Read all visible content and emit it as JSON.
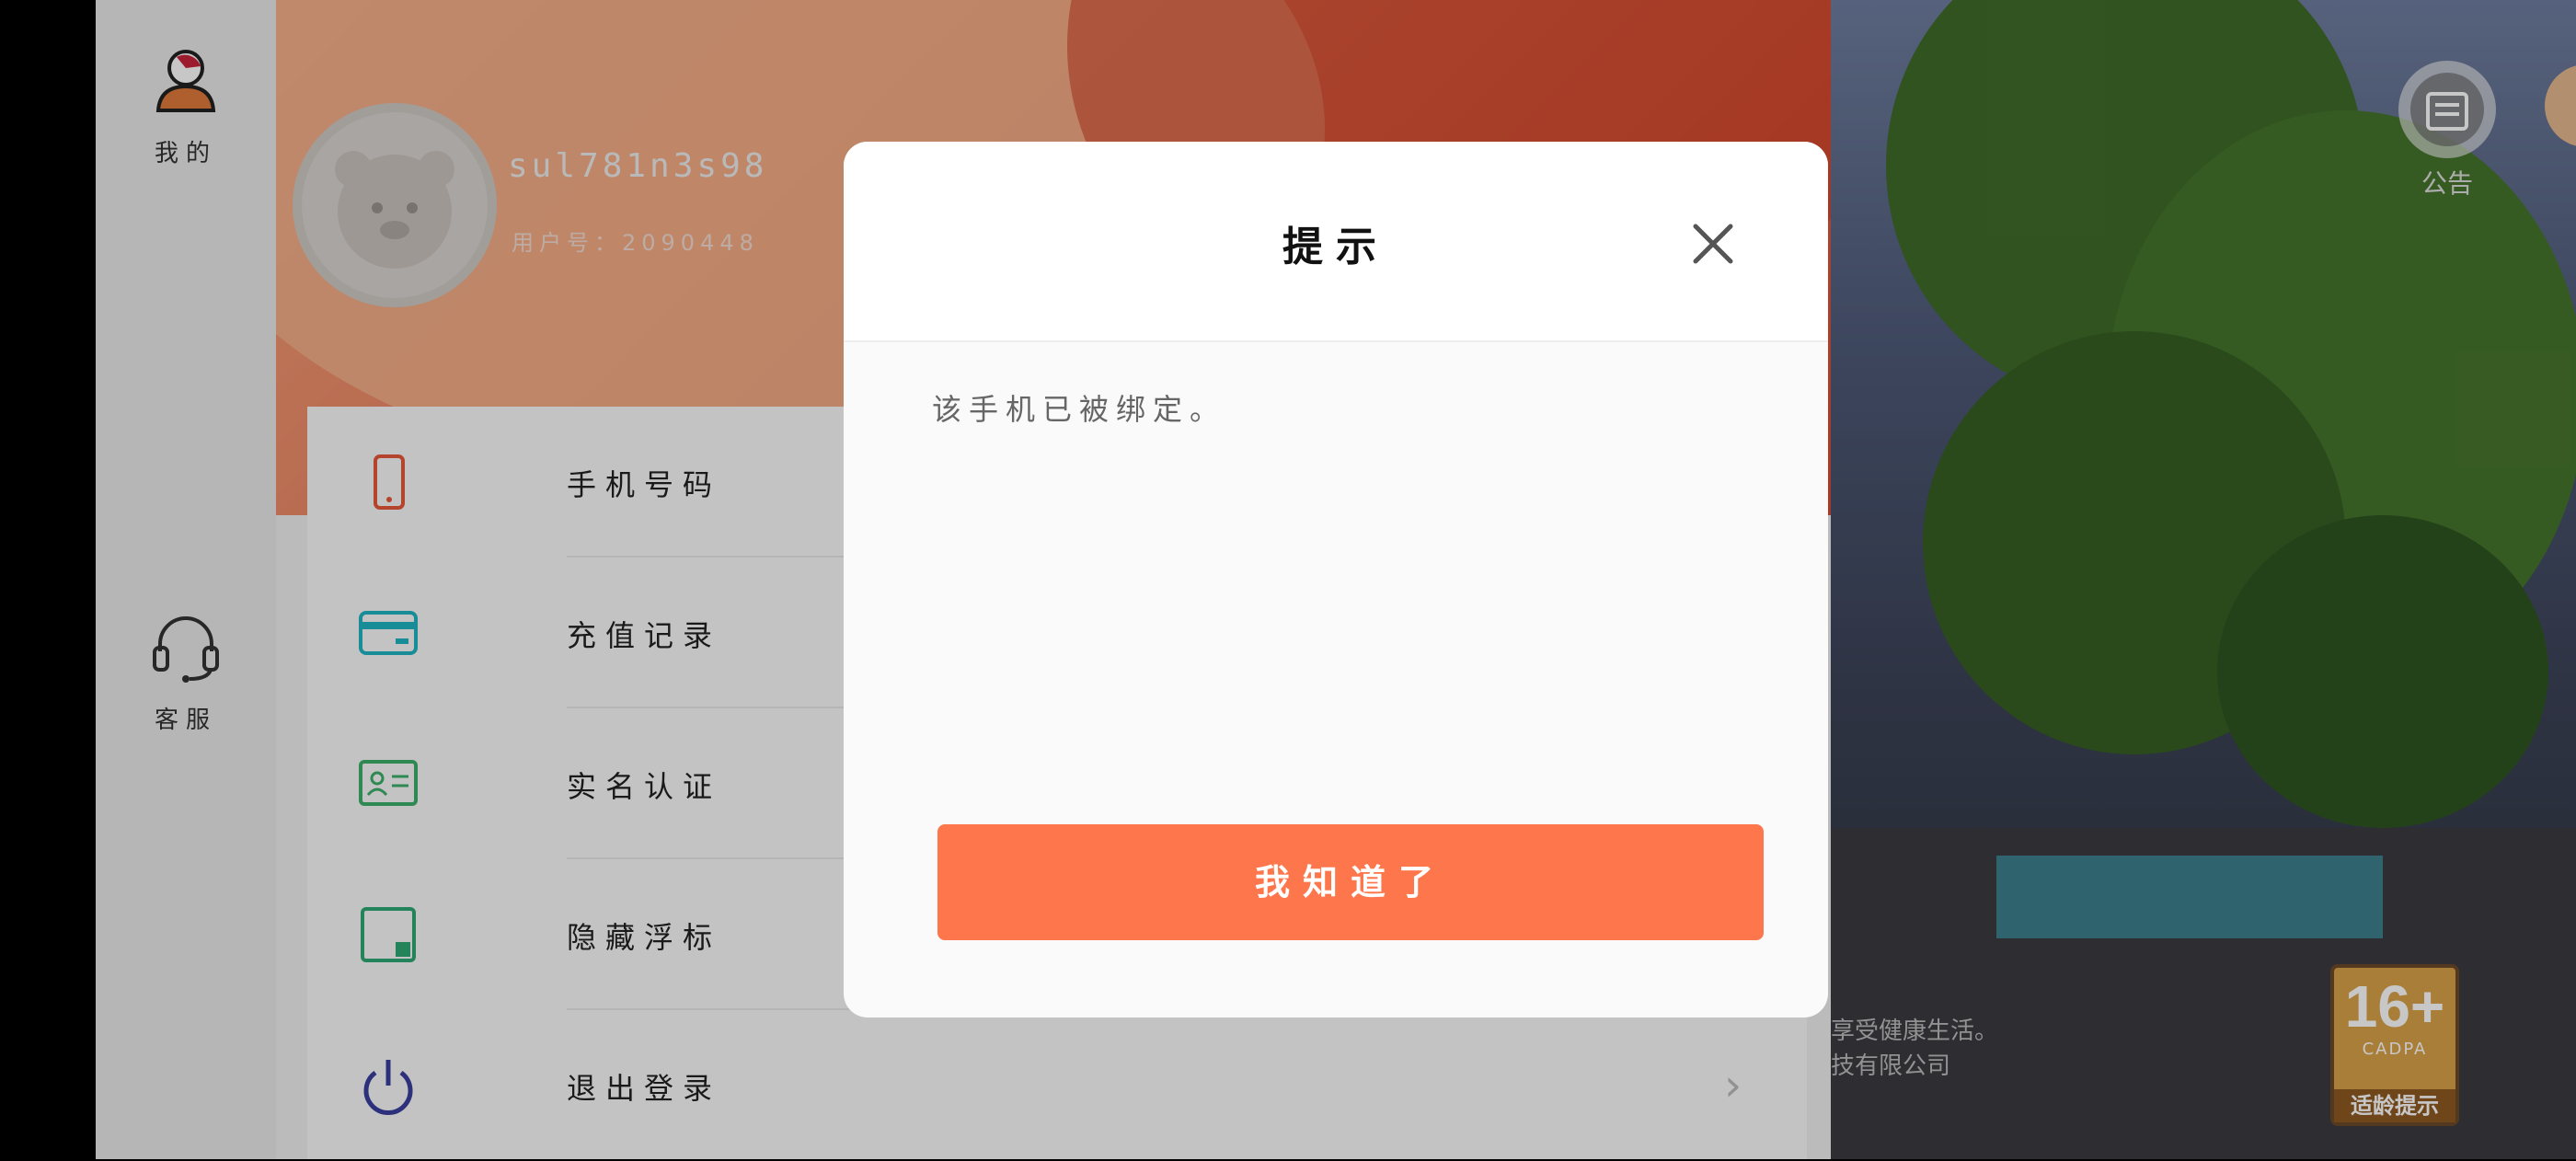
{
  "sidebar": {
    "items": [
      {
        "label": "我的",
        "icon": "person-icon"
      },
      {
        "label": "客服",
        "icon": "headset-icon"
      }
    ]
  },
  "profile": {
    "username": "sul781n3s98",
    "user_id": "用户号：2090448"
  },
  "menu": {
    "items": [
      {
        "label": "手机号码",
        "icon": "phone-icon",
        "color": "#e8583a"
      },
      {
        "label": "充值记录",
        "icon": "card-icon",
        "color": "#1fb5c2"
      },
      {
        "label": "实名认证",
        "icon": "id-card-icon",
        "color": "#3cb06a"
      },
      {
        "label": "隐藏浮标",
        "icon": "float-hide-icon",
        "color": "#2da874"
      },
      {
        "label": "退出登录",
        "icon": "power-icon",
        "color": "#3a3f9e"
      }
    ]
  },
  "game": {
    "notice_label": "公告",
    "age_rating": {
      "big": "16+",
      "small": "CADPA",
      "foot": "适龄提示"
    },
    "footer_line1": "享受健康生活。",
    "footer_line2": "技有限公司"
  },
  "dialog": {
    "title": "提示",
    "message": "该手机已被绑定。",
    "confirm_label": "我知道了",
    "button_color": "#fe774c"
  }
}
